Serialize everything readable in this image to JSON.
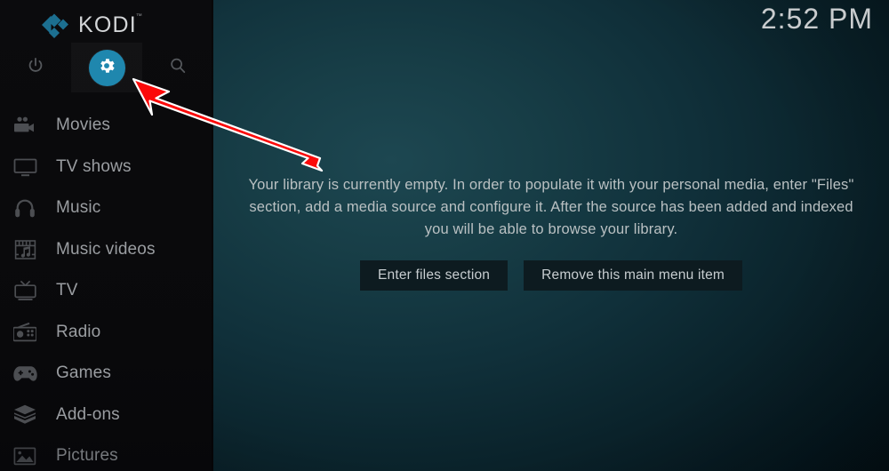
{
  "app": {
    "name": "KODI",
    "logo_icon": "kodi-diamond-logo",
    "trademark": "™",
    "accent_color": "#1f87ae"
  },
  "clock": {
    "time": "2:52 PM"
  },
  "top_actions": [
    {
      "id": "power",
      "icon": "power-icon",
      "label": "Power"
    },
    {
      "id": "settings",
      "icon": "gear-icon",
      "label": "Settings",
      "selected": true
    },
    {
      "id": "search",
      "icon": "search-icon",
      "label": "Search"
    }
  ],
  "sidebar": {
    "items": [
      {
        "label": "Movies",
        "icon": "movie-camera-icon"
      },
      {
        "label": "TV shows",
        "icon": "tv-monitor-icon"
      },
      {
        "label": "Music",
        "icon": "headphones-icon"
      },
      {
        "label": "Music videos",
        "icon": "film-music-icon"
      },
      {
        "label": "TV",
        "icon": "television-icon"
      },
      {
        "label": "Radio",
        "icon": "radio-icon"
      },
      {
        "label": "Games",
        "icon": "gamepad-icon"
      },
      {
        "label": "Add-ons",
        "icon": "addon-box-icon"
      },
      {
        "label": "Pictures",
        "icon": "picture-icon"
      }
    ]
  },
  "main": {
    "empty_message": "Your library is currently empty. In order to populate it with your personal media, enter \"Files\" section, add a media source and configure it. After the source has been added and indexed you will be able to browse your library.",
    "buttons": [
      {
        "label": "Enter files section"
      },
      {
        "label": "Remove this main menu item"
      }
    ]
  },
  "annotation": {
    "arrow_color": "#fb0a0a",
    "arrow_outline_color": "#ffffff",
    "points_to": "settings-gear-button"
  }
}
